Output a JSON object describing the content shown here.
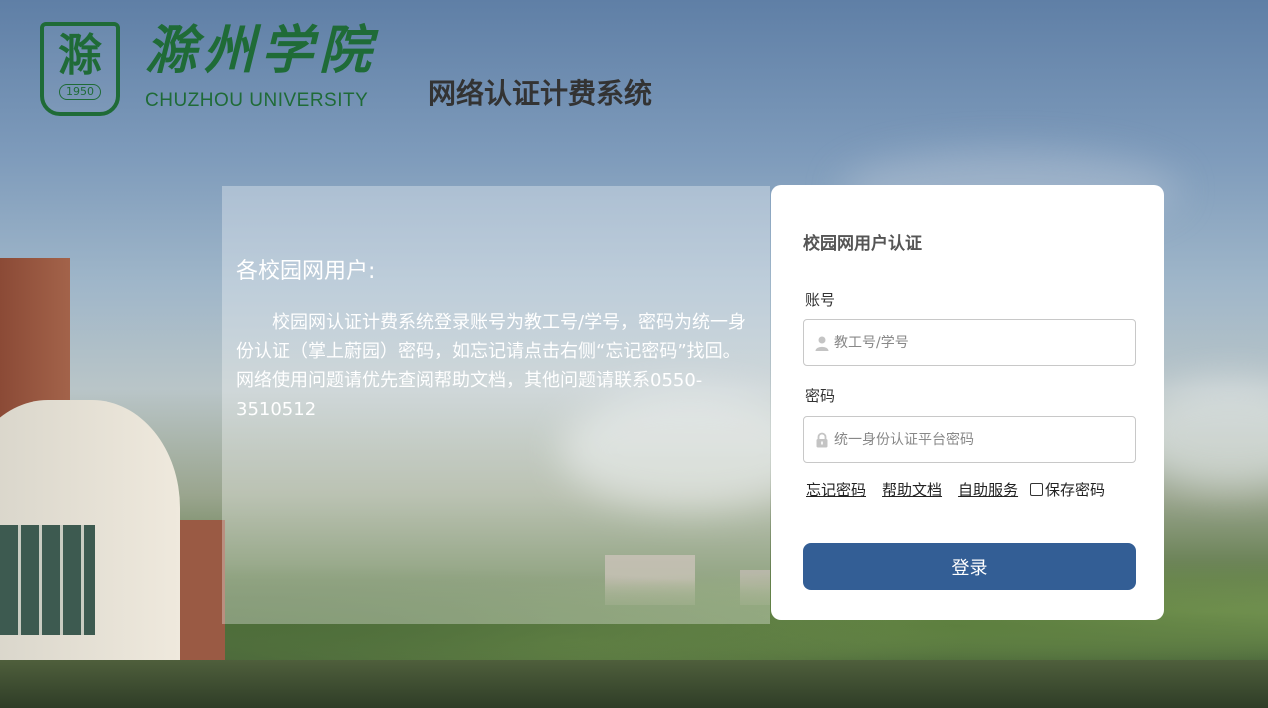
{
  "header": {
    "logo_cn": "滁州学院",
    "logo_en": "CHUZHOU UNIVERSITY",
    "logo_year": "1950",
    "system_title": "网络认证计费系统"
  },
  "notice": {
    "heading": "各校园网用户:",
    "body": "校园网认证计费系统登录账号为教工号/学号，密码为统一身份认证（掌上蔚园）密码，如忘记请点击右侧“忘记密码”找回。网络使用问题请优先查阅帮助文档，其他问题请联系0550-3510512"
  },
  "login": {
    "title": "校园网用户认证",
    "account_label": "账号",
    "account_placeholder": "教工号/学号",
    "account_value": "",
    "password_label": "密码",
    "password_placeholder": "统一身份认证平台密码",
    "password_value": "",
    "forgot_link": "忘记密码",
    "help_link": "帮助文档",
    "self_service_link": "自助服务",
    "save_password_label": "保存密码",
    "save_password_checked": false,
    "submit_label": "登录"
  },
  "icons": {
    "account": "user-icon",
    "password": "lock-icon"
  },
  "colors": {
    "brand_green": "#1f6b37",
    "button_blue": "#335e95"
  }
}
